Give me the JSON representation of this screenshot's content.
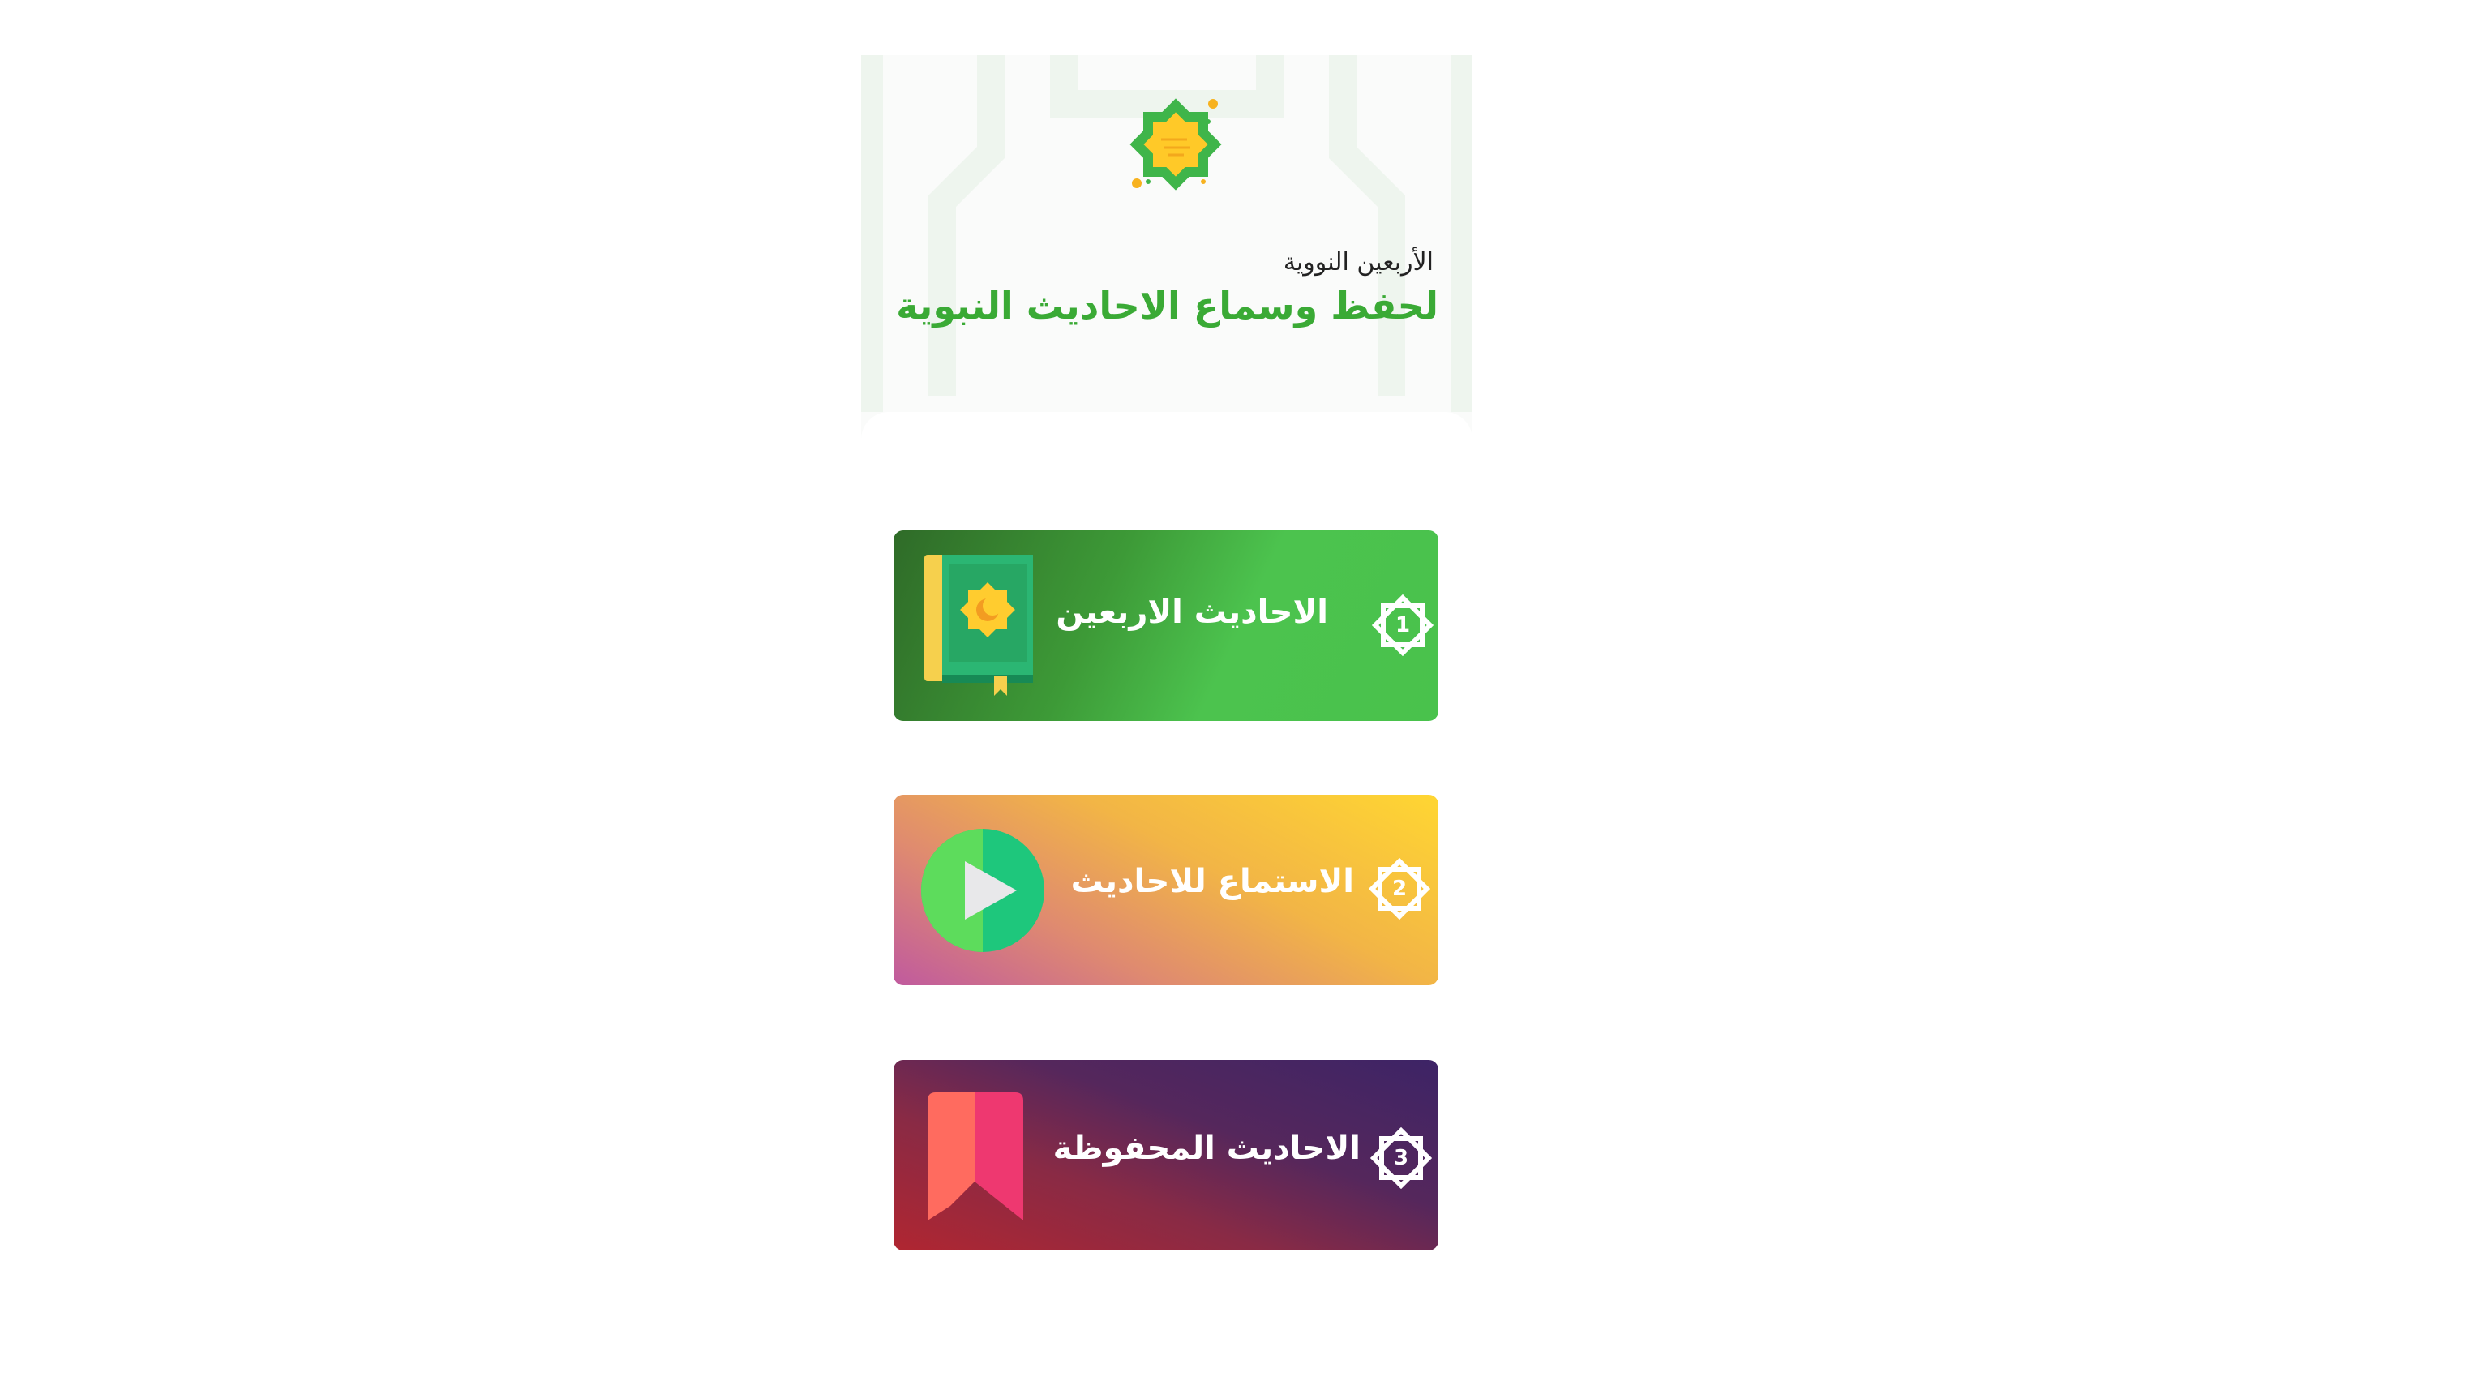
{
  "header": {
    "subtitle": "الأربعين النووية",
    "title": "لحفظ وسماع الاحاديث النبوية",
    "logo_icon": "octagram-star-icon"
  },
  "menu": {
    "items": [
      {
        "number": "1",
        "label": "الاحاديث الاربعين",
        "icon": "quran-book-icon",
        "colors": [
          "#2f6b28",
          "#4cc34e"
        ]
      },
      {
        "number": "2",
        "label": "الاستماع للاحاديث",
        "icon": "play-circle-icon",
        "colors": [
          "#c05a9e",
          "#ffd632"
        ]
      },
      {
        "number": "3",
        "label": "الاحاديث المحفوظة",
        "icon": "bookmark-icon",
        "colors": [
          "#b02631",
          "#3d2466"
        ]
      }
    ]
  },
  "colors": {
    "accent": "#3aaa35",
    "background": "#fafbfa"
  }
}
